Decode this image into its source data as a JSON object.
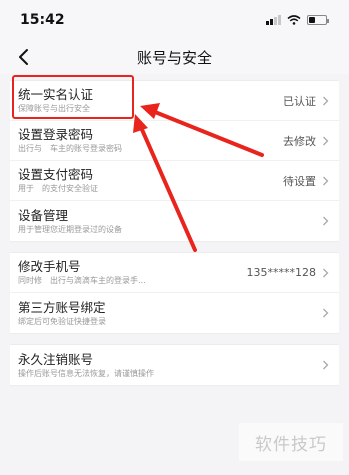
{
  "status": {
    "time": "15:42"
  },
  "nav": {
    "title": "账号与安全"
  },
  "groups": [
    {
      "items": [
        {
          "title": "统一实名认证",
          "sub": "保障账号与出行安全",
          "value": "已认证"
        },
        {
          "title": "设置登录密码",
          "sub": "出行与　车主的账号登录密码",
          "value": "去修改"
        },
        {
          "title": "设置支付密码",
          "sub": "用于　的支付安全验证",
          "value": "待设置"
        },
        {
          "title": "设备管理",
          "sub": "用于管理您近期登录过的设备",
          "value": ""
        }
      ]
    },
    {
      "items": [
        {
          "title": "修改手机号",
          "sub": "同时修　出行与滴滴车主的登录手...",
          "value": "135*****128"
        },
        {
          "title": "第三方账号绑定",
          "sub": "绑定后可免验证快捷登录",
          "value": ""
        }
      ]
    },
    {
      "items": [
        {
          "title": "永久注销账号",
          "sub": "操作后账号信息无法恢复，请谨慎操作",
          "value": ""
        }
      ]
    }
  ],
  "watermark": "软件技巧",
  "colors": {
    "annotation": "#e8241c"
  }
}
